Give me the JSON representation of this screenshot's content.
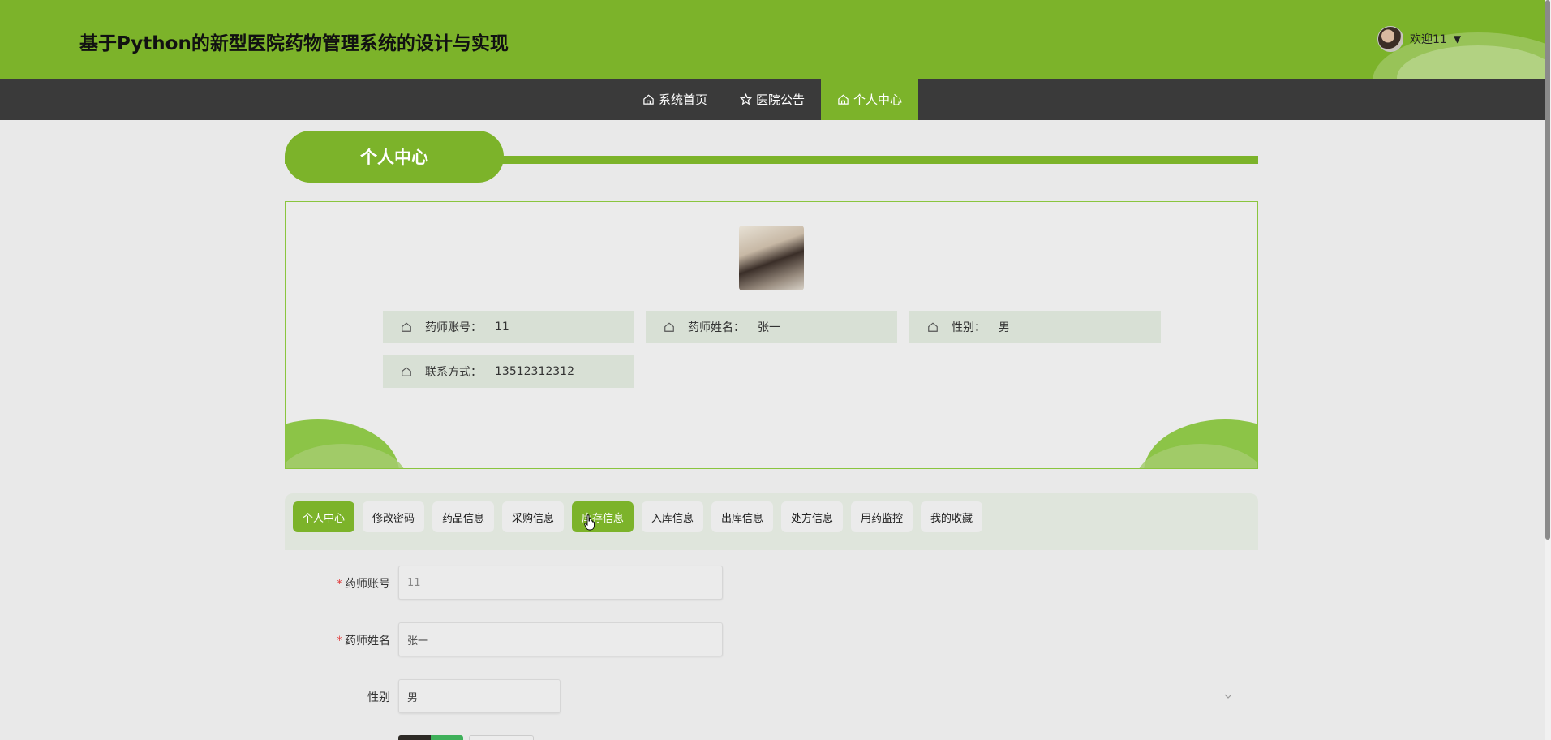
{
  "header": {
    "title": "基于Python的新型医院药物管理系统的设计与实现",
    "welcome": "欢迎11",
    "caret": "▼"
  },
  "nav": {
    "items": [
      {
        "label": "系统首页",
        "icon": "home-icon"
      },
      {
        "label": "医院公告",
        "icon": "star-icon"
      },
      {
        "label": "个人中心",
        "icon": "home-icon"
      }
    ],
    "active_index": 2
  },
  "section": {
    "title": "个人中心"
  },
  "profile": {
    "account_label": "药师账号：",
    "account_value": "11",
    "name_label": "药师姓名：",
    "name_value": "张一",
    "gender_label": "性别：",
    "gender_value": "男",
    "phone_label": "联系方式：",
    "phone_value": "13512312312"
  },
  "tabs": [
    {
      "label": "个人中心"
    },
    {
      "label": "修改密码"
    },
    {
      "label": "药品信息"
    },
    {
      "label": "采购信息"
    },
    {
      "label": "库存信息"
    },
    {
      "label": "入库信息"
    },
    {
      "label": "出库信息"
    },
    {
      "label": "处方信息"
    },
    {
      "label": "用药监控"
    },
    {
      "label": "我的收藏"
    }
  ],
  "form": {
    "account_label": "药师账号",
    "account_value": "11",
    "name_label": "药师姓名",
    "name_value": "张一",
    "gender_label": "性别",
    "gender_value": "男",
    "required_mark": "*"
  },
  "colors": {
    "primary": "#7cb32a",
    "nav_bg": "#3a3a3a",
    "page_bg": "#e9e9e9"
  }
}
